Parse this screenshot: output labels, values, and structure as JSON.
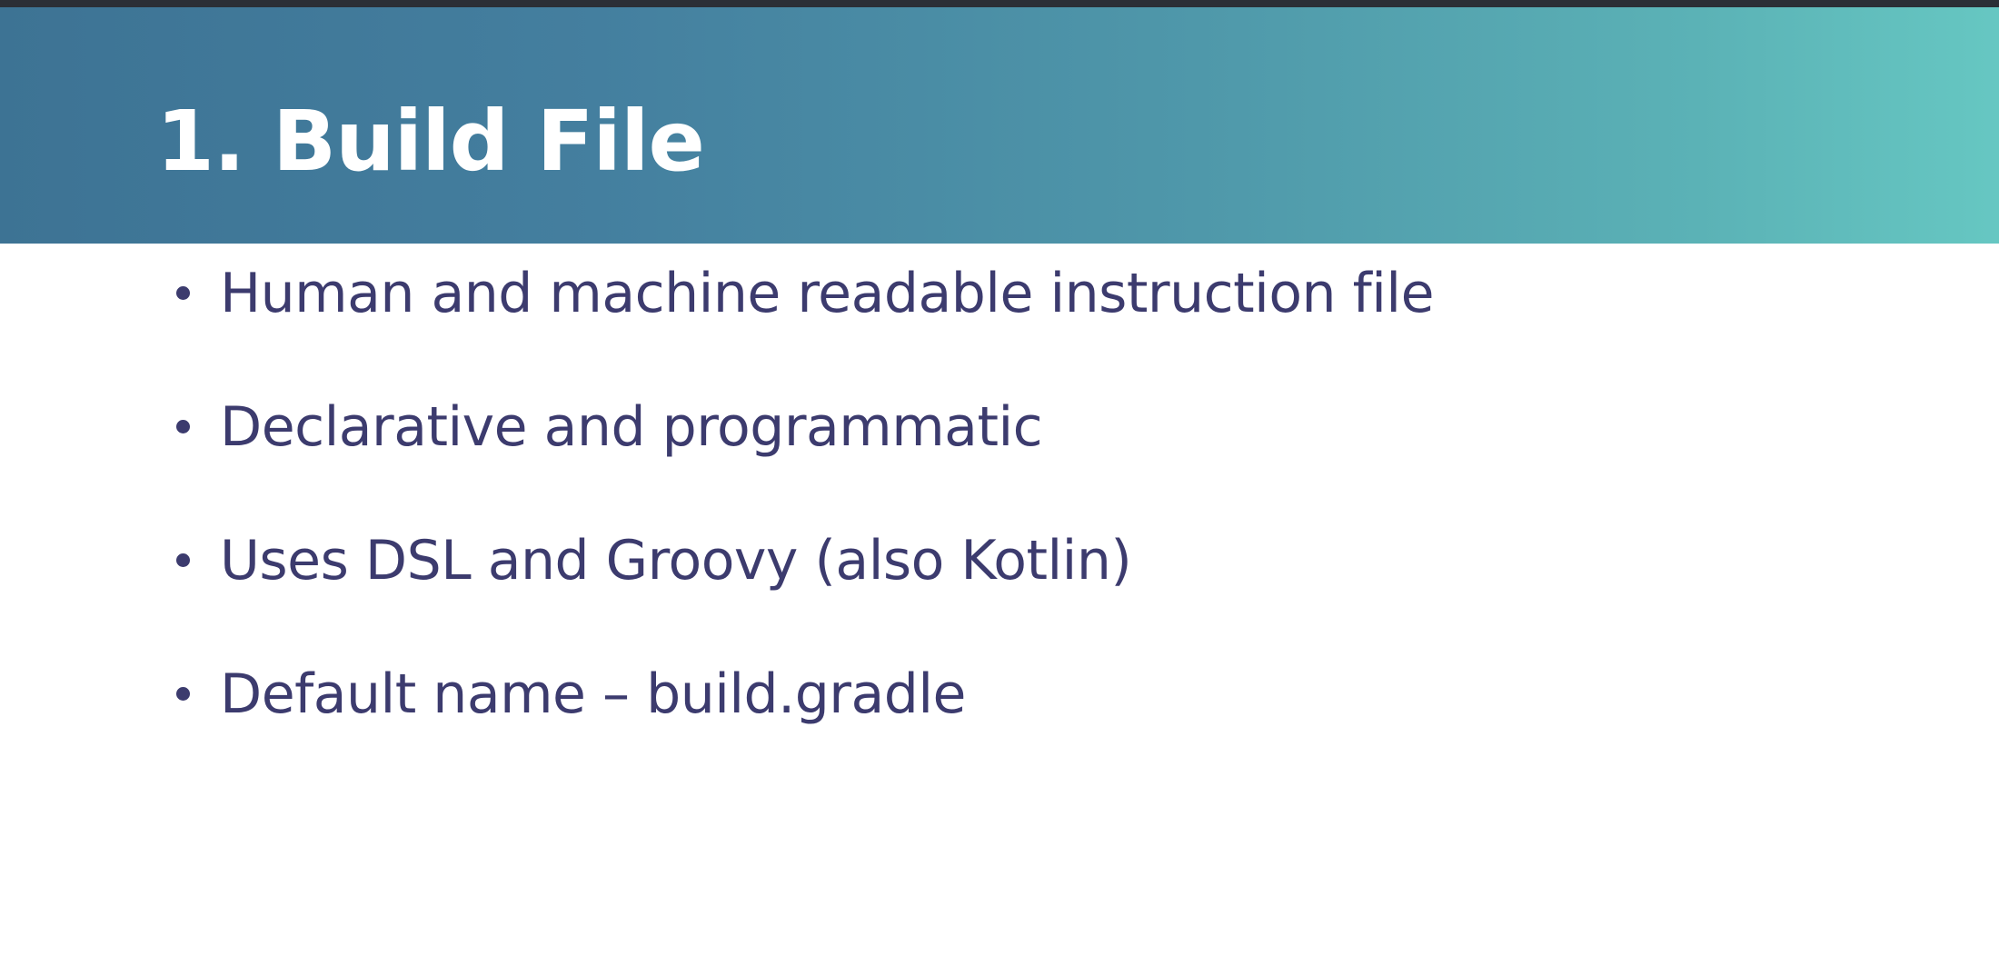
{
  "slide": {
    "title": "1. Build File",
    "bullets": [
      "Human and machine readable instruction file",
      "Declarative and programmatic",
      "Uses DSL and Groovy (also Kotlin)",
      "Default name – build.gradle"
    ]
  },
  "colors": {
    "header_gradient_start": "#3d7394",
    "header_gradient_end": "#66c7c2",
    "title_text": "#ffffff",
    "body_text": "#3c3b6e",
    "background": "#ffffff"
  }
}
